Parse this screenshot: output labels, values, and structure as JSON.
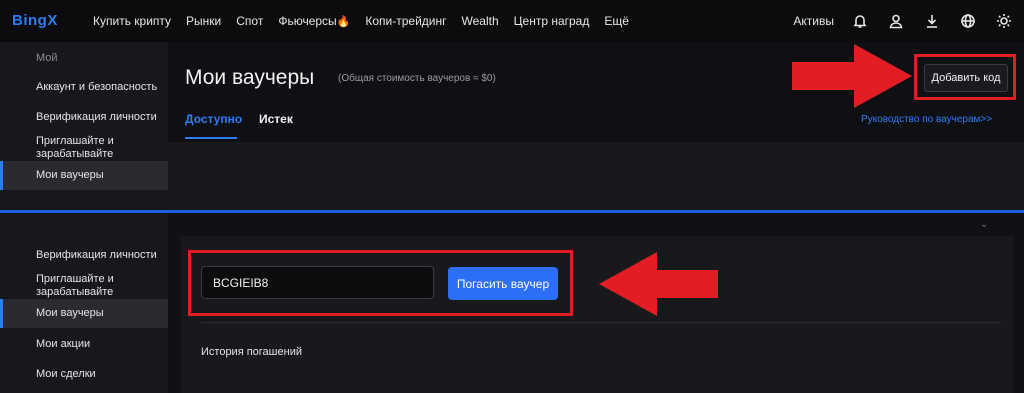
{
  "nav": {
    "logo": "BingX",
    "items": [
      "Купить крипту",
      "Рынки",
      "Спот",
      "Фьючерсы",
      "Копи-трейдинг",
      "Wealth",
      "Центр наград",
      "Ещё"
    ],
    "futures_badge": "🔥",
    "assets_label": "Активы",
    "icons": [
      "bell-icon",
      "user-icon",
      "download-icon",
      "globe-icon",
      "sun-icon"
    ]
  },
  "sidebar_top": {
    "section_label": "Мой",
    "items": [
      "Аккаунт и безопасность",
      "Верификация личности",
      "Приглашайте и зарабатывайте",
      "Мои ваучеры"
    ],
    "active": "Мои ваучеры"
  },
  "page": {
    "title": "Мои ваучеры",
    "subtitle": "(Общая стоимость ваучеров ≈ $0)",
    "add_code_button": "Добавить код",
    "tabs": [
      "Доступно",
      "Истек"
    ],
    "active_tab": "Доступно",
    "guide_link": "Руководство по ваучерам>>"
  },
  "sidebar_bottom": {
    "items": [
      "Верификация личности",
      "Приглашайте и зарабатывайте",
      "Мои ваучеры",
      "Мои акции",
      "Мои сделки"
    ],
    "active": "Мои ваучеры"
  },
  "redeem": {
    "code_value": "BCGIEIB8",
    "redeem_button": "Погасить ваучер",
    "history_label": "История погашений"
  },
  "colors": {
    "accent": "#2d7cf6",
    "annotation_red": "#e21d24",
    "background": "#0f1013"
  }
}
